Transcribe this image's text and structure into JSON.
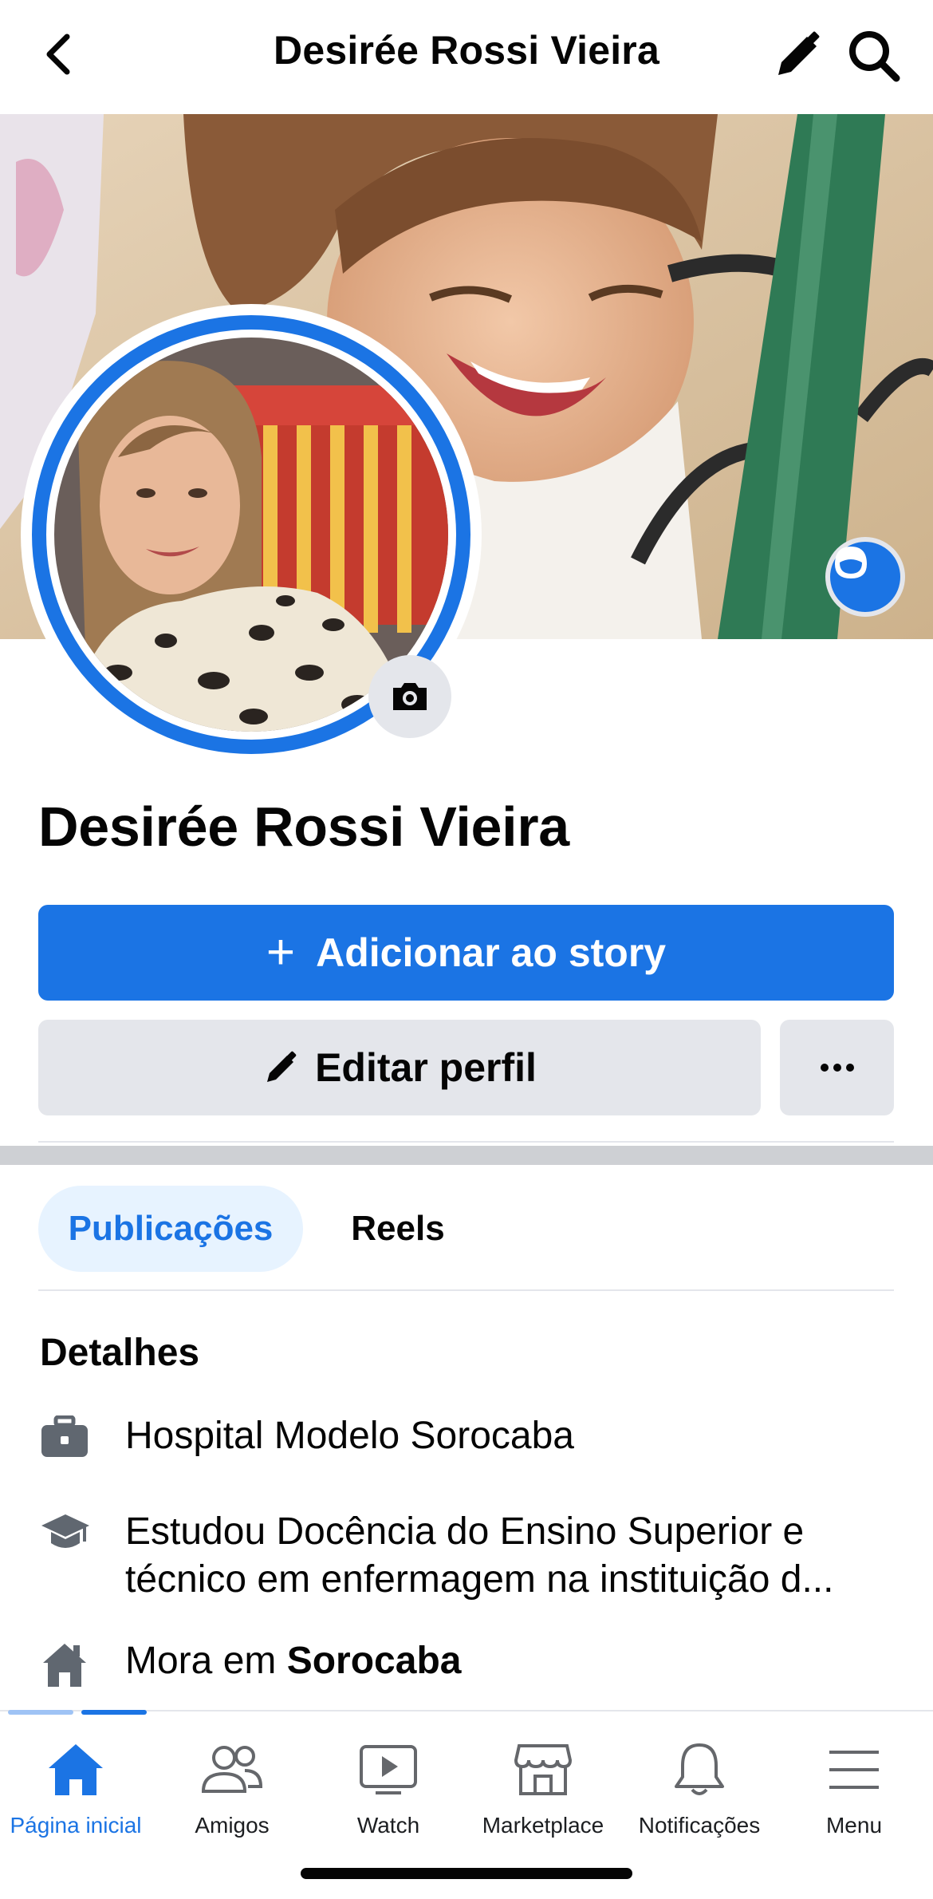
{
  "header": {
    "title": "Desirée Rossi Vieira"
  },
  "profile": {
    "name": "Desirée Rossi Vieira",
    "add_story_label": "Adicionar ao story",
    "add_story_plus": "+",
    "edit_profile_label": "Editar perfil",
    "more_label": "···"
  },
  "tabs": [
    {
      "label": "Publicações",
      "active": true
    },
    {
      "label": "Reels",
      "active": false
    }
  ],
  "details": {
    "title": "Detalhes",
    "items": [
      {
        "icon": "briefcase-icon",
        "text": "Hospital Modelo Sorocaba"
      },
      {
        "icon": "graduation-cap-icon",
        "line1": "Estudou Docência do Ensino Superior e",
        "line2": "técnico em enfermagem na instituição d..."
      },
      {
        "icon": "house-icon",
        "prefix": "Mora em ",
        "bold": "Sorocaba"
      }
    ]
  },
  "bottom_nav": [
    {
      "label": "Página inicial",
      "icon": "home-icon",
      "active": true
    },
    {
      "label": "Amigos",
      "icon": "friends-icon",
      "active": false
    },
    {
      "label": "Watch",
      "icon": "watch-icon",
      "active": false
    },
    {
      "label": "Marketplace",
      "icon": "marketplace-icon",
      "active": false
    },
    {
      "label": "Notificações",
      "icon": "bell-icon",
      "active": false
    },
    {
      "label": "Menu",
      "icon": "menu-icon",
      "active": false
    }
  ],
  "colors": {
    "accent": "#1b74e4",
    "button_gray": "#e4e6eb",
    "tab_active_bg": "#e7f3ff"
  }
}
